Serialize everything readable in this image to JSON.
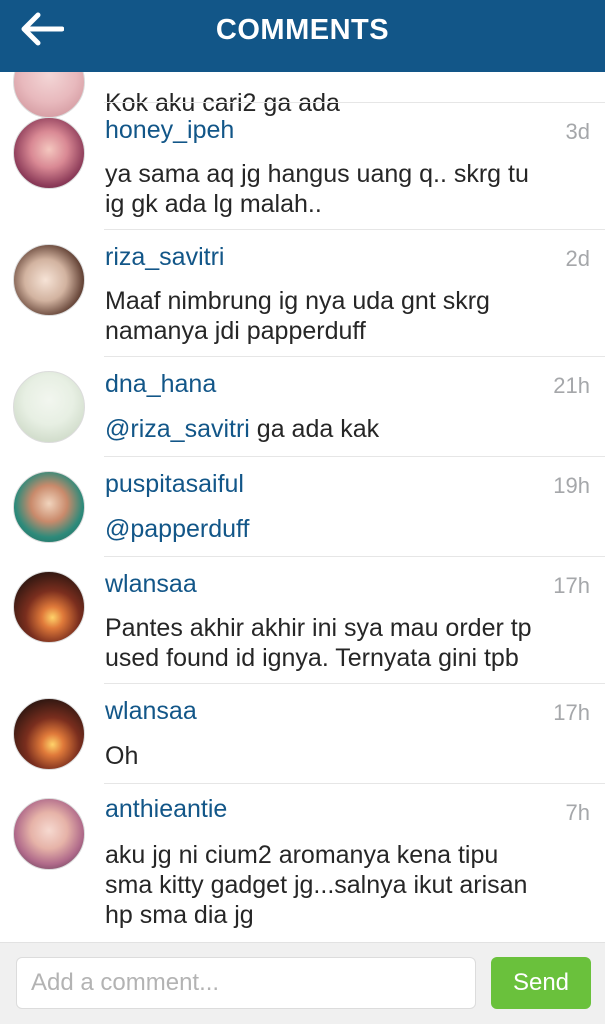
{
  "header": {
    "title": "COMMENTS",
    "back_icon": "back-arrow-icon"
  },
  "partial_comment": {
    "text": "Kok aku cari2 ga ada"
  },
  "comments": [
    {
      "username": "honey_ipeh",
      "time": "3d",
      "lines": [
        "ya sama aq jg hangus uang q.. skrg tu",
        "ig gk ada lg malah.."
      ]
    },
    {
      "username": "riza_savitri",
      "time": "2d",
      "lines": [
        "Maaf nimbrung ig nya uda gnt skrg",
        "namanya jdi papperduff"
      ]
    },
    {
      "username": "dna_hana",
      "time": "21h",
      "mention": "@riza_savitri",
      "text_after_mention": " ga ada kak"
    },
    {
      "username": "puspitasaiful",
      "time": "19h",
      "mention": "@papperduff"
    },
    {
      "username": "wlansaa",
      "time": "17h",
      "lines": [
        "Pantes akhir akhir ini sya mau order tp",
        "used found id ignya. Ternyata gini tpb"
      ]
    },
    {
      "username": "wlansaa",
      "time": "17h",
      "lines": [
        "Oh"
      ]
    },
    {
      "username": "anthieantie",
      "time": "7h",
      "lines": [
        "aku jg ni cium2 aromanya kena tipu",
        "sma kitty gadget jg...salnya ikut arisan",
        "hp sma dia jg"
      ]
    }
  ],
  "footer": {
    "input_placeholder": "Add a comment...",
    "send_label": "Send"
  },
  "colors": {
    "header_bg": "#125688",
    "username": "#125688",
    "send_button": "#6ac13c",
    "timestamp": "#a5a7aa"
  }
}
